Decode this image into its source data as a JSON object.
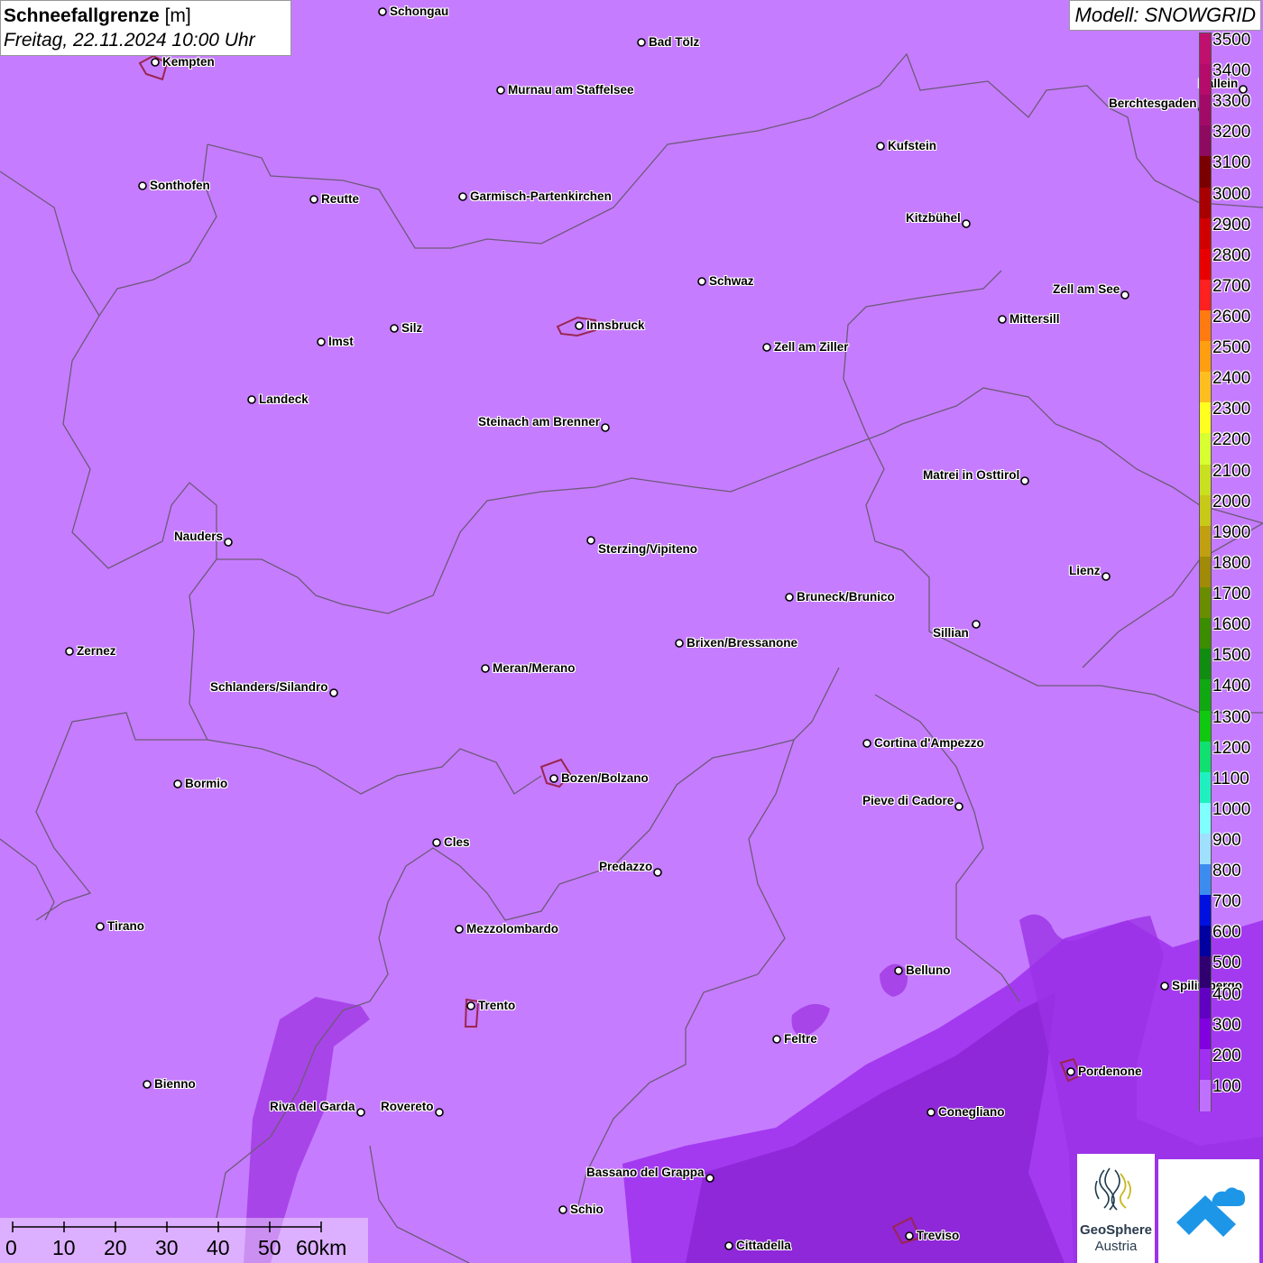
{
  "title": {
    "main": "Schneefallgrenze",
    "unit": "[m]",
    "datetime": "Freitag, 22.11.2024 10:00 Uhr"
  },
  "model": "Modell: SNOWGRID",
  "legend": {
    "levels": [
      "3500",
      "3400",
      "3300",
      "3200",
      "3100",
      "3000",
      "2900",
      "2800",
      "2700",
      "2600",
      "2500",
      "2400",
      "2300",
      "2200",
      "2100",
      "2000",
      "1900",
      "1800",
      "1700",
      "1600",
      "1500",
      "1400",
      "1300",
      "1200",
      "1100",
      "1000",
      "900",
      "800",
      "700",
      "600",
      "500",
      "400",
      "300",
      "200",
      "100"
    ],
    "colors": [
      "#c0106e",
      "#b50c6b",
      "#a20a68",
      "#8e0a60",
      "#7a0000",
      "#a80000",
      "#d00000",
      "#e80000",
      "#ff2020",
      "#ff7a10",
      "#ff9e10",
      "#ffbe20",
      "#ffff20",
      "#d8ff30",
      "#c8e020",
      "#c8c818",
      "#c0a010",
      "#a08a08",
      "#6a8c00",
      "#3c8c00",
      "#108c10",
      "#10a810",
      "#10c810",
      "#10e070",
      "#20f0c0",
      "#80ffff",
      "#a0e0ff",
      "#3c8cf0",
      "#0010e0",
      "#0000a0",
      "#300070",
      "#6000c0",
      "#8000e0",
      "#a030f0",
      "#c070ff"
    ]
  },
  "cities": [
    {
      "name": "Schongau"
    },
    {
      "name": "Bad Tölz"
    },
    {
      "name": "Kempten"
    },
    {
      "name": "Murnau am Staffelsee"
    },
    {
      "name": "Hallein"
    },
    {
      "name": "Berchtesgaden"
    },
    {
      "name": "Kufstein"
    },
    {
      "name": "Sonthofen"
    },
    {
      "name": "Reutte"
    },
    {
      "name": "Garmisch-Partenkirchen"
    },
    {
      "name": "Kitzbühel"
    },
    {
      "name": "Schwaz"
    },
    {
      "name": "Zell am See"
    },
    {
      "name": "Innsbruck"
    },
    {
      "name": "Mittersill"
    },
    {
      "name": "Silz"
    },
    {
      "name": "Imst"
    },
    {
      "name": "Zell am Ziller"
    },
    {
      "name": "Landeck"
    },
    {
      "name": "Steinach am Brenner"
    },
    {
      "name": "Matrei in Osttirol"
    },
    {
      "name": "Nauders"
    },
    {
      "name": "Sterzing/Vipiteno"
    },
    {
      "name": "Lienz"
    },
    {
      "name": "Bruneck/Brunico"
    },
    {
      "name": "Sillian"
    },
    {
      "name": "Zernez"
    },
    {
      "name": "Brixen/Bressanone"
    },
    {
      "name": "Meran/Merano"
    },
    {
      "name": "Schlanders/Silandro"
    },
    {
      "name": "Cortina d'Ampezzo"
    },
    {
      "name": "Bozen/Bolzano"
    },
    {
      "name": "Bormio"
    },
    {
      "name": "Pieve di Cadore"
    },
    {
      "name": "Cles"
    },
    {
      "name": "Predazzo"
    },
    {
      "name": "Tirano"
    },
    {
      "name": "Mezzolombardo"
    },
    {
      "name": "Belluno"
    },
    {
      "name": "Spilimbergo"
    },
    {
      "name": "Trento"
    },
    {
      "name": "Feltre"
    },
    {
      "name": "Pordenone"
    },
    {
      "name": "Bienno"
    },
    {
      "name": "Riva del Garda"
    },
    {
      "name": "Rovereto"
    },
    {
      "name": "Conegliano"
    },
    {
      "name": "Bassano del Grappa"
    },
    {
      "name": "Schio"
    },
    {
      "name": "Treviso"
    },
    {
      "name": "Cittadella"
    }
  ],
  "scale": {
    "ticks": [
      "0",
      "10",
      "20",
      "30",
      "40",
      "50",
      "60km"
    ]
  },
  "logos": {
    "geosphere_line1": "GeoSphere",
    "geosphere_line2": "Austria"
  }
}
